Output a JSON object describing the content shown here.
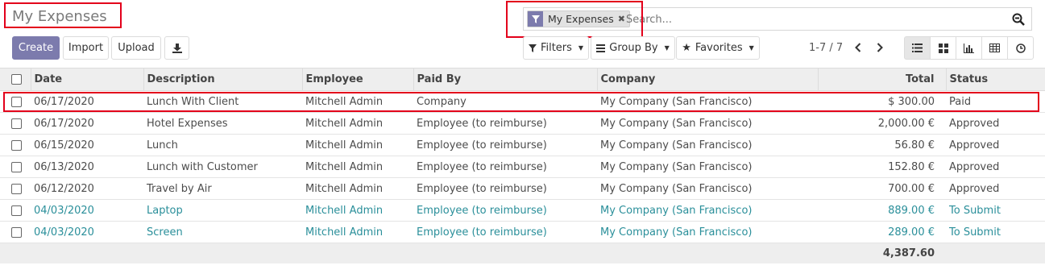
{
  "page": {
    "title": "My Expenses"
  },
  "search": {
    "facet_label": "My Expenses",
    "facet_icon": "filter-icon",
    "placeholder": "Search...",
    "search_icon": "magnifier-icon"
  },
  "toolbar": {
    "create_label": "Create",
    "import_label": "Import",
    "upload_label": "Upload",
    "download_icon": "download-icon",
    "filters_label": "Filters",
    "groupby_label": "Group By",
    "favorites_label": "Favorites"
  },
  "pager": {
    "text": "1-7 / 7"
  },
  "views": [
    "list-view-icon",
    "kanban-view-icon",
    "graph-view-icon",
    "pivot-view-icon",
    "activity-view-icon"
  ],
  "table": {
    "columns": [
      "Date",
      "Description",
      "Employee",
      "Paid By",
      "Company",
      "Total",
      "Status"
    ],
    "rows": [
      {
        "date": "06/17/2020",
        "description": "Lunch With Client",
        "employee": "Mitchell Admin",
        "paid_by": "Company",
        "company": "My Company (San Francisco)",
        "total": "$ 300.00",
        "status": "Paid"
      },
      {
        "date": "06/17/2020",
        "description": "Hotel Expenses",
        "employee": "Mitchell Admin",
        "paid_by": "Employee (to reimburse)",
        "company": "My Company (San Francisco)",
        "total": "2,000.00 €",
        "status": "Approved"
      },
      {
        "date": "06/15/2020",
        "description": "Lunch",
        "employee": "Mitchell Admin",
        "paid_by": "Employee (to reimburse)",
        "company": "My Company (San Francisco)",
        "total": "56.80 €",
        "status": "Approved"
      },
      {
        "date": "06/13/2020",
        "description": "Lunch with Customer",
        "employee": "Mitchell Admin",
        "paid_by": "Employee (to reimburse)",
        "company": "My Company (San Francisco)",
        "total": "152.80 €",
        "status": "Approved"
      },
      {
        "date": "06/12/2020",
        "description": "Travel by Air",
        "employee": "Mitchell Admin",
        "paid_by": "Employee (to reimburse)",
        "company": "My Company (San Francisco)",
        "total": "700.00 €",
        "status": "Approved"
      },
      {
        "date": "04/03/2020",
        "description": "Laptop",
        "employee": "Mitchell Admin",
        "paid_by": "Employee (to reimburse)",
        "company": "My Company (San Francisco)",
        "total": "889.00 €",
        "status": "To Submit"
      },
      {
        "date": "04/03/2020",
        "description": "Screen",
        "employee": "Mitchell Admin",
        "paid_by": "Employee (to reimburse)",
        "company": "My Company (San Francisco)",
        "total": "289.00 €",
        "status": "To Submit"
      }
    ],
    "footer_total": "4,387.60"
  },
  "colors": {
    "primary": "#7c7bad",
    "to_submit": "#2a8f9a",
    "highlight": "#e3001b"
  }
}
